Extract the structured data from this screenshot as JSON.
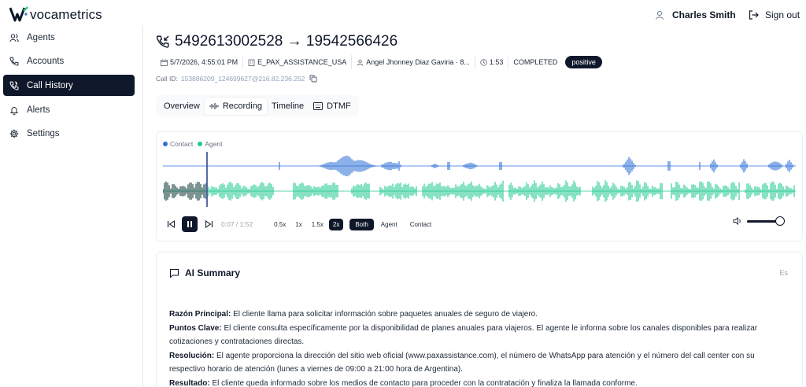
{
  "app": {
    "brand": "vocametrics",
    "user_name": "Charles Smith",
    "sign_out": "Sign out"
  },
  "sidebar": {
    "items": [
      {
        "label": "Agents",
        "icon": "users-icon"
      },
      {
        "label": "Accounts",
        "icon": "phone-icon"
      },
      {
        "label": "Call History",
        "icon": "phone-history-icon",
        "active": true
      },
      {
        "label": "Alerts",
        "icon": "bell-icon"
      },
      {
        "label": "Settings",
        "icon": "gear-icon"
      }
    ]
  },
  "call": {
    "title": "5492613002528 → 19542566426",
    "datetime": "5/7/2026, 4:55:01 PM",
    "account": "E_PAX_ASSISTANCE_USA",
    "agent": "Angel Jhonney Diaz Gaviria · 8...",
    "duration": "1:53",
    "status": "COMPLETED",
    "sentiment": "positive",
    "call_id_label": "Call ID:",
    "call_id": "153886209_124699627@216.82.236.252"
  },
  "tabs": [
    {
      "label": "Overview"
    },
    {
      "label": "Recording",
      "active": true
    },
    {
      "label": "Timeline"
    },
    {
      "label": "DTMF"
    }
  ],
  "player": {
    "legend_contact": "Contact",
    "legend_agent": "Agent",
    "time": "0:07 / 1:52",
    "progress": 0.0625,
    "speeds": [
      "0.5x",
      "1x",
      "1.5x",
      "2x"
    ],
    "active_speed": "2x",
    "modes": [
      "Both",
      "Agent",
      "Contact"
    ],
    "active_mode": "Both",
    "volume": 1.0,
    "colors": {
      "contact": "#2f6fd6",
      "agent": "#22c98f",
      "played": "#0f3d3a"
    }
  },
  "summary": {
    "heading": "AI Summary",
    "lang": "Es",
    "rows": [
      {
        "label": "Razón Principal:",
        "text": "El cliente llama para solicitar información sobre paquetes anuales de seguro de viajero."
      },
      {
        "label": "Puntos Clave:",
        "text": "El cliente consulta específicamente por la disponibilidad de planes anuales para viajeros. El agente le informa sobre los canales disponibles para realizar cotizaciones y contrataciones directas."
      },
      {
        "label": "Resolución:",
        "text": "El agente proporciona la dirección del sitio web oficial (www.paxassistance.com), el número de WhatsApp para atención y el número del call center con su respectivo horario de atención (lunes a viernes de 09:00 a 21:00 hora de Argentina)."
      },
      {
        "label": "Resultado:",
        "text": "El cliente queda informado sobre los medios de contacto para proceder con la contratación y finaliza la llamada conforme."
      }
    ]
  }
}
